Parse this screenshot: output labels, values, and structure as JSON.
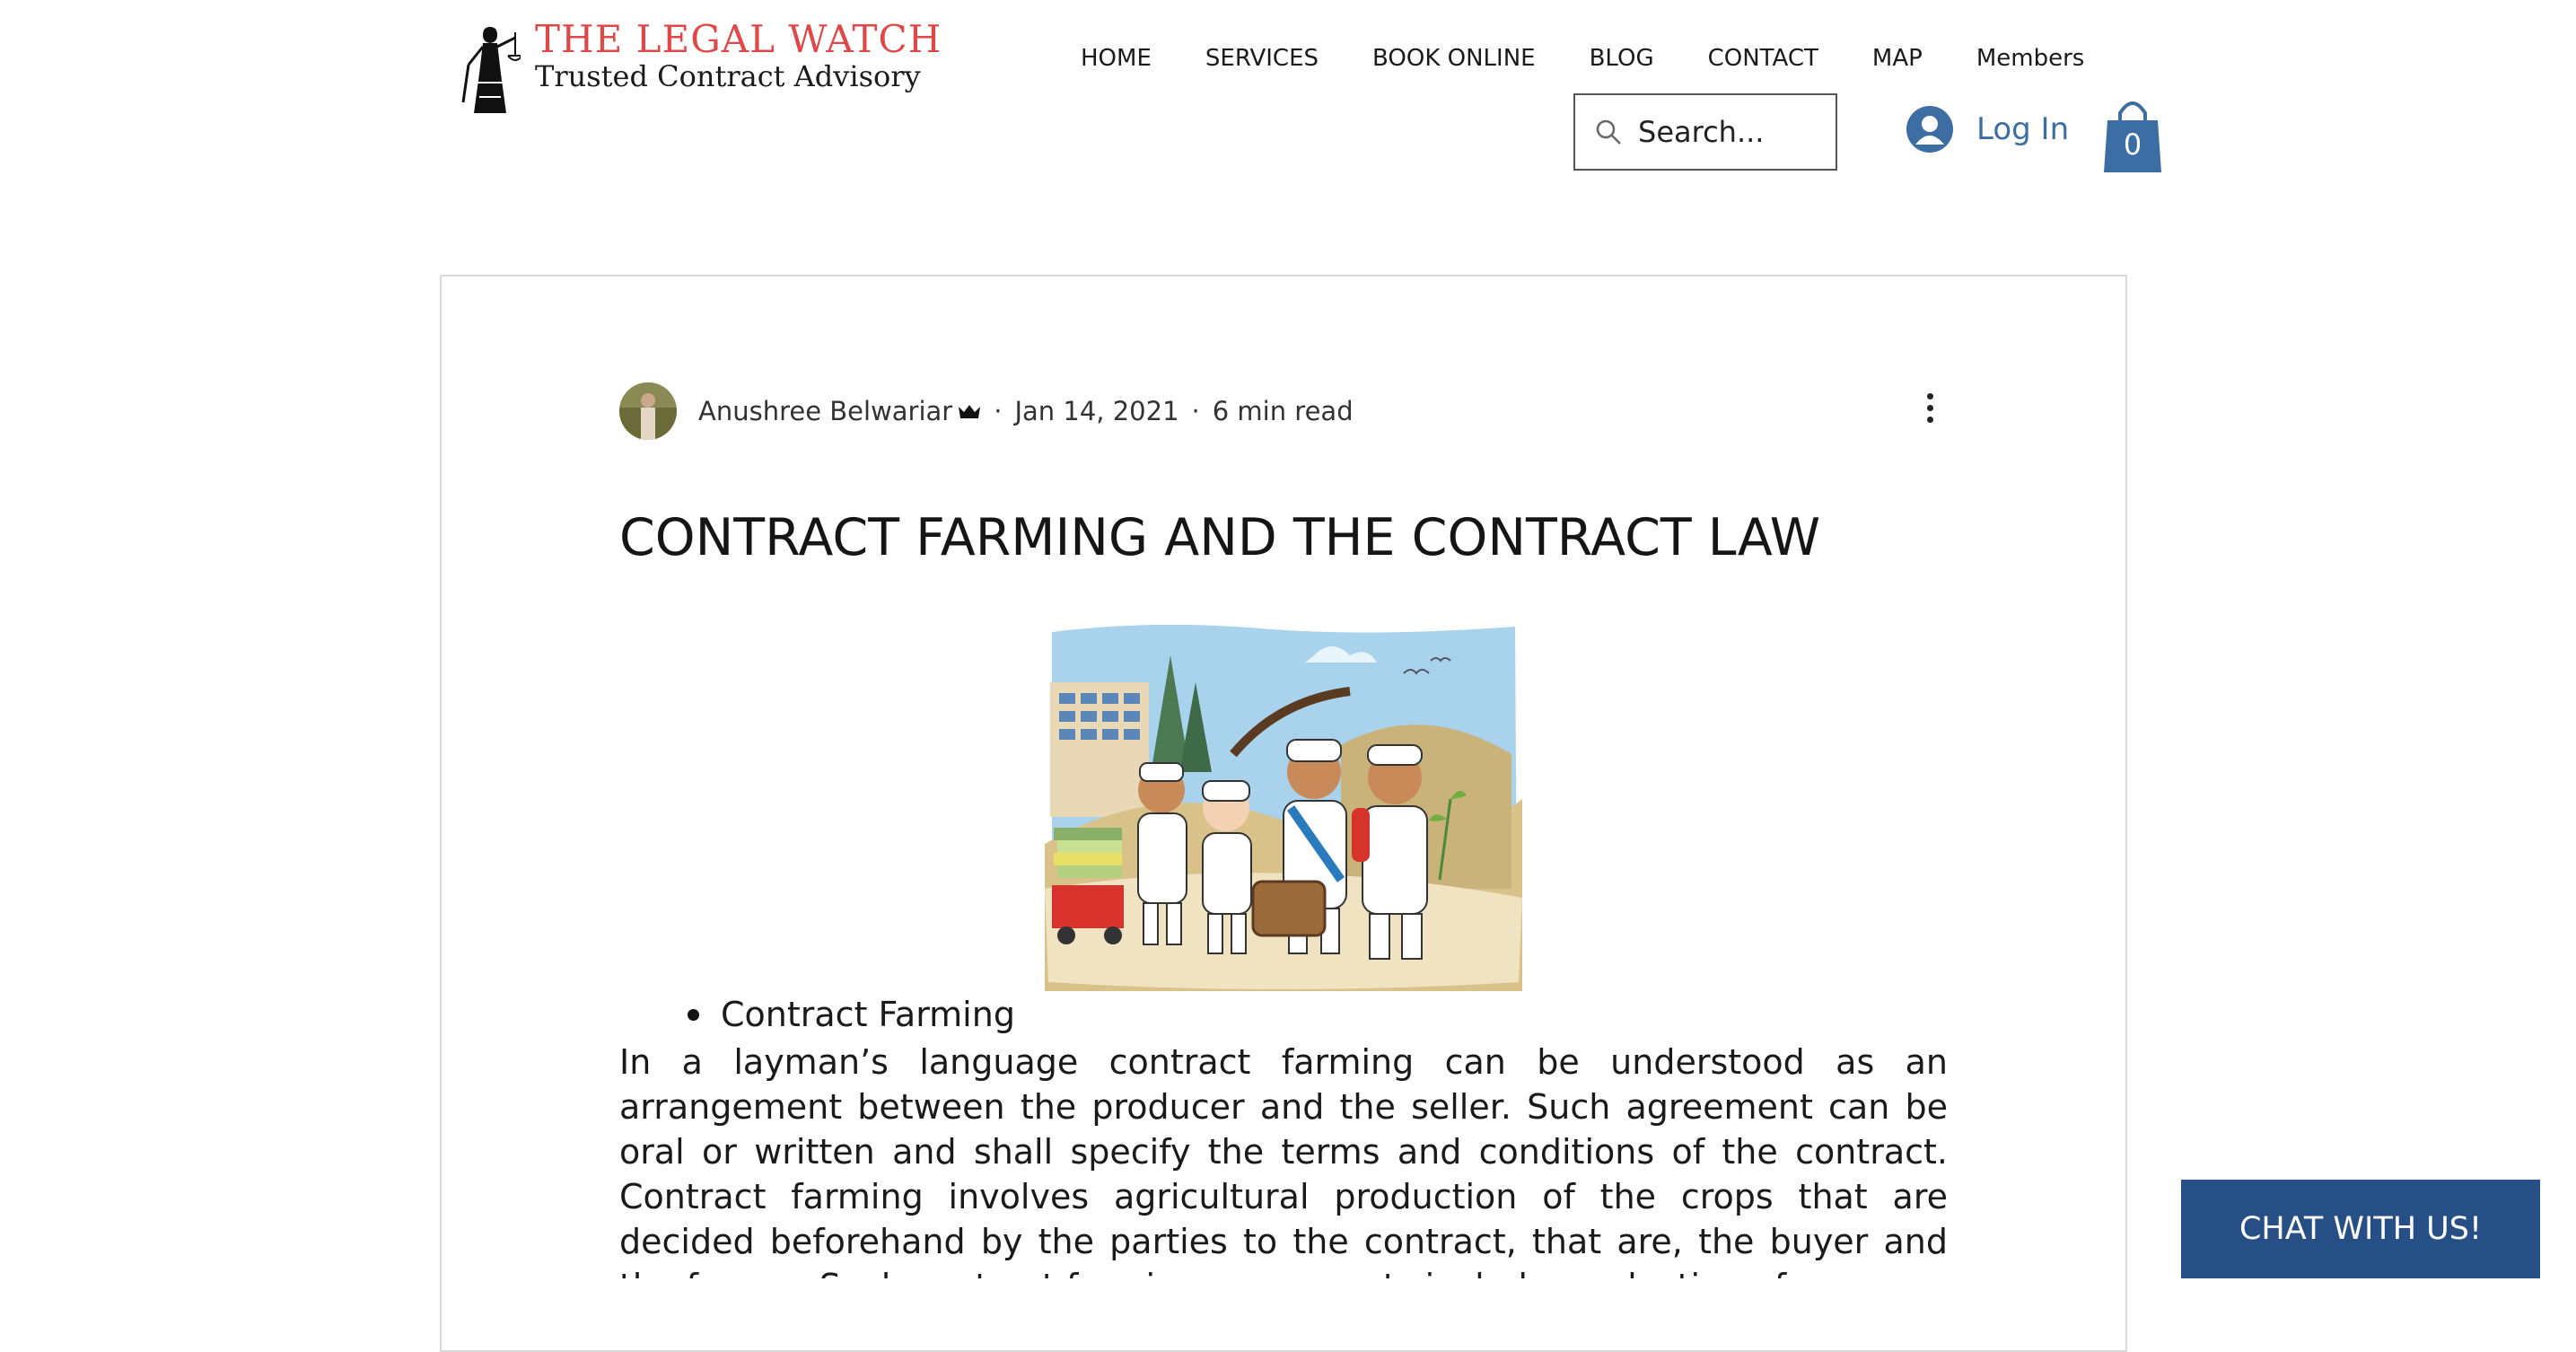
{
  "brand": {
    "title": "THE LEGAL WATCH",
    "subtitle": "Trusted Contract Advisory",
    "title_color": "#e04848",
    "logo_icon": "lady-justice-icon"
  },
  "nav": {
    "items": [
      {
        "label": "HOME"
      },
      {
        "label": "SERVICES"
      },
      {
        "label": "BOOK ONLINE"
      },
      {
        "label": "BLOG"
      },
      {
        "label": "CONTACT"
      },
      {
        "label": "MAP"
      },
      {
        "label": "Members"
      }
    ]
  },
  "search": {
    "placeholder": "Search...",
    "icon": "search-icon"
  },
  "login": {
    "label": "Log In",
    "icon": "user-avatar-icon",
    "color": "#3c6ea3"
  },
  "cart": {
    "count": "0",
    "icon": "shopping-bag-icon",
    "color": "#3c6ea3"
  },
  "post": {
    "author": "Anushree Belwariar",
    "author_badge_icon": "crown-icon",
    "separator": "·",
    "date": "Jan 14, 2021",
    "read_time": "6 min read",
    "more_icon": "more-vertical-icon",
    "title": "CONTRACT FARMING AND THE CONTRACT LAW",
    "bullet": "Contract Farming",
    "body": "In a layman’s language contract farming can be understood as an arrangement between the producer and the seller. Such agreement can be oral or written and shall specify the terms and conditions of the contract. Contract farming involves agricultural production of the crops that are decided beforehand by the parties to the contract, that are, the buyer and the farmer. Such contract farming agreements include production of"
  },
  "chat": {
    "label": "CHAT WITH US!",
    "background": "#264f86"
  }
}
